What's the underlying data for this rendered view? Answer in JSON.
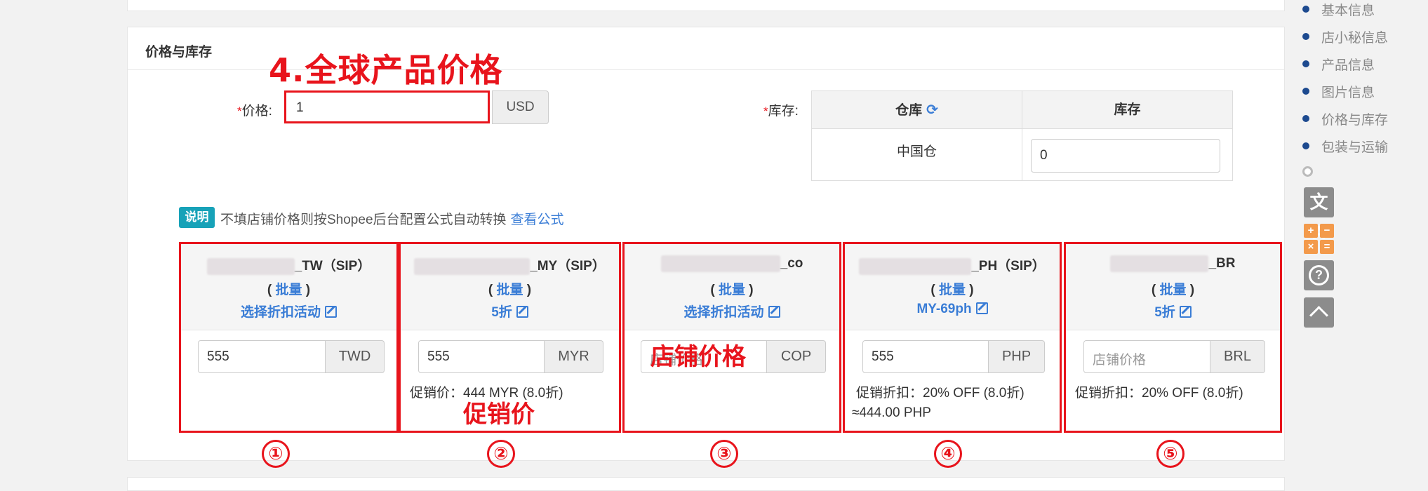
{
  "section": {
    "title": "价格与库存"
  },
  "annotation": {
    "title": "4.全球产品价格",
    "store_price": "店铺价格",
    "promo_price": "促销价",
    "circles": [
      "①",
      "②",
      "③",
      "④",
      "⑤"
    ]
  },
  "price": {
    "required_mark": "*",
    "label": "价格:",
    "value": "1",
    "currency": "USD"
  },
  "stock": {
    "required_mark": "*",
    "label": "库存:",
    "col_warehouse": "仓库",
    "col_stock": "库存",
    "warehouse": "中国仓",
    "value": "0",
    "refresh_icon": "refresh-icon"
  },
  "note": {
    "badge": "说明",
    "text": "不填店铺价格则按Shopee后台配置公式自动转换",
    "link": "查看公式"
  },
  "shops": [
    {
      "name_suffix": "_TW（SIP）",
      "batch_open": "(",
      "batch": "批量",
      "batch_close": ")",
      "discount": "选择折扣活动",
      "price": "555",
      "placeholder": "",
      "currency": "TWD",
      "promo": "",
      "promo2": ""
    },
    {
      "name_suffix": "_MY（SIP）",
      "batch_open": "(",
      "batch": "批量",
      "batch_close": ")",
      "discount": "5折",
      "price": "555",
      "placeholder": "",
      "currency": "MYR",
      "promo": "促销价：444 MYR (8.0折)",
      "promo2": ""
    },
    {
      "name_suffix": "_co",
      "batch_open": "(",
      "batch": "批量",
      "batch_close": ")",
      "discount": "选择折扣活动",
      "price": "",
      "placeholder": "店铺价格",
      "currency": "COP",
      "promo": "",
      "promo2": ""
    },
    {
      "name_suffix": "_PH（SIP）",
      "batch_open": "(",
      "batch": "批量",
      "batch_close": ")",
      "discount": "MY-69ph",
      "price": "555",
      "placeholder": "",
      "currency": "PHP",
      "promo": "促销折扣：20% OFF (8.0折)",
      "promo2": "≈444.00 PHP"
    },
    {
      "name_suffix": "_BR",
      "batch_open": "(",
      "batch": "批量",
      "batch_close": ")",
      "discount": "5折",
      "price": "",
      "placeholder": "店铺价格",
      "currency": "BRL",
      "promo": "促销折扣：20% OFF (8.0折)",
      "promo2": ""
    }
  ],
  "nav": {
    "items": [
      "基本信息",
      "店小秘信息",
      "产品信息",
      "图片信息",
      "价格与库存",
      "包装与运输"
    ]
  },
  "tools": {
    "translate": "文A",
    "calc": [
      "+",
      "−",
      "×",
      "="
    ],
    "help": "?",
    "icons": [
      "translate-icon",
      "calculator-icon",
      "help-icon",
      "back-to-top-icon"
    ]
  }
}
